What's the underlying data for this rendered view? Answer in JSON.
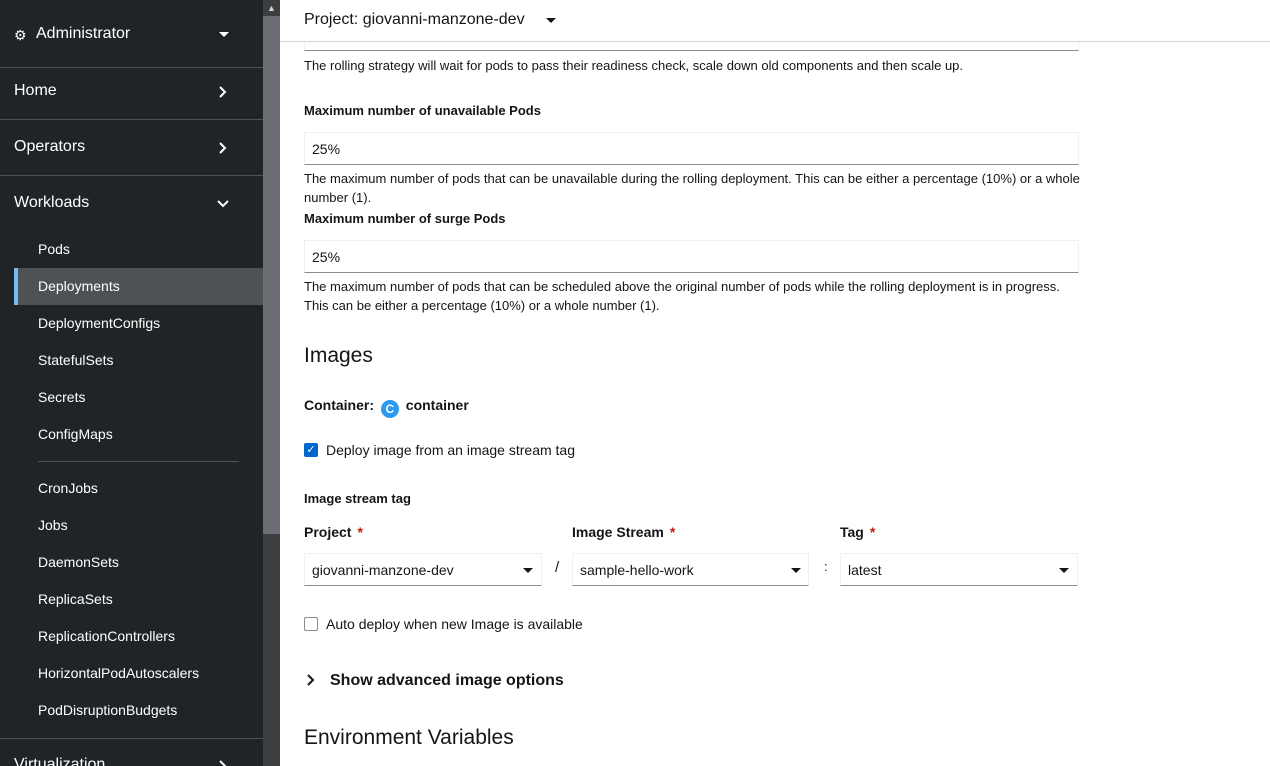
{
  "sidebar": {
    "perspective": "Administrator",
    "sections": {
      "home": "Home",
      "operators": "Operators",
      "workloads": "Workloads",
      "virtualization": "Virtualization"
    },
    "workload_items": [
      "Pods",
      "Deployments",
      "DeploymentConfigs",
      "StatefulSets",
      "Secrets",
      "ConfigMaps",
      "CronJobs",
      "Jobs",
      "DaemonSets",
      "ReplicaSets",
      "ReplicationControllers",
      "HorizontalPodAutoscalers",
      "PodDisruptionBudgets"
    ],
    "active_item": "Deployments"
  },
  "header": {
    "project_label": "Project: giovanni-manzone-dev"
  },
  "form": {
    "rolling_help": "The rolling strategy will wait for pods to pass their readiness check, scale down old components and then scale up.",
    "max_unavailable": {
      "label": "Maximum number of unavailable Pods",
      "value": "25%",
      "help": "The maximum number of pods that can be unavailable during the rolling deployment. This can be either a percentage (10%) or a whole number (1)."
    },
    "max_surge": {
      "label": "Maximum number of surge Pods",
      "value": "25%",
      "help": "The maximum number of pods that can be scheduled above the original number of pods while the rolling deployment is in progress. This can be either a percentage (10%) or a whole number (1)."
    },
    "images": {
      "title": "Images",
      "container_label": "Container:",
      "container_badge": "C",
      "container_name": "container",
      "deploy_from_stream_label": "Deploy image from an image stream tag",
      "deploy_from_stream_checked": true,
      "image_stream_tag_label": "Image stream tag",
      "project_label": "Project",
      "project_value": "giovanni-manzone-dev",
      "separator": "/",
      "image_stream_label": "Image Stream",
      "image_stream_value": "sample-hello-work",
      "tag_separator": ":",
      "tag_label": "Tag",
      "tag_value": "latest",
      "required_marker": "*",
      "auto_deploy_label": "Auto deploy when new Image is available",
      "auto_deploy_checked": false,
      "advanced_toggle": "Show advanced image options"
    },
    "env_title": "Environment Variables"
  },
  "colors": {
    "sidebar_bg": "#212427",
    "active_item_bg": "#4f5255",
    "active_indicator": "#73bcf7",
    "primary": "#0066cc",
    "required": "#c9190b"
  }
}
